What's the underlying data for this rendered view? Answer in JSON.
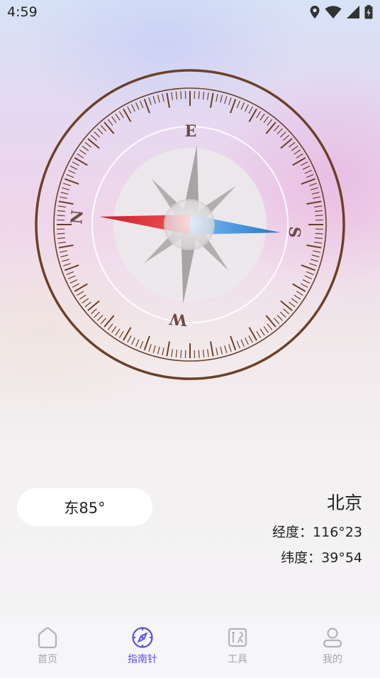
{
  "status_bar": {
    "time": "4:59"
  },
  "compass": {
    "letters": {
      "e": "E",
      "s": "S",
      "w": "W",
      "n": "N"
    },
    "colors": {
      "ring": "#6b4028",
      "needle_red": "#e0262c",
      "needle_blue": "#2f86d8",
      "star": "#a7a4a5"
    }
  },
  "direction": {
    "label": "东85°"
  },
  "location": {
    "city": "北京",
    "longitude": "经度：116°23",
    "latitude": "纬度：39°54"
  },
  "tabs": [
    {
      "label": "首页",
      "icon": "home-icon"
    },
    {
      "label": "指南针",
      "icon": "compass-icon"
    },
    {
      "label": "工具",
      "icon": "tools-icon"
    },
    {
      "label": "我的",
      "icon": "user-icon"
    }
  ],
  "active_tab": "指南针",
  "colors": {
    "accent": "#5b53d6",
    "inactive": "#a8a8ad"
  }
}
